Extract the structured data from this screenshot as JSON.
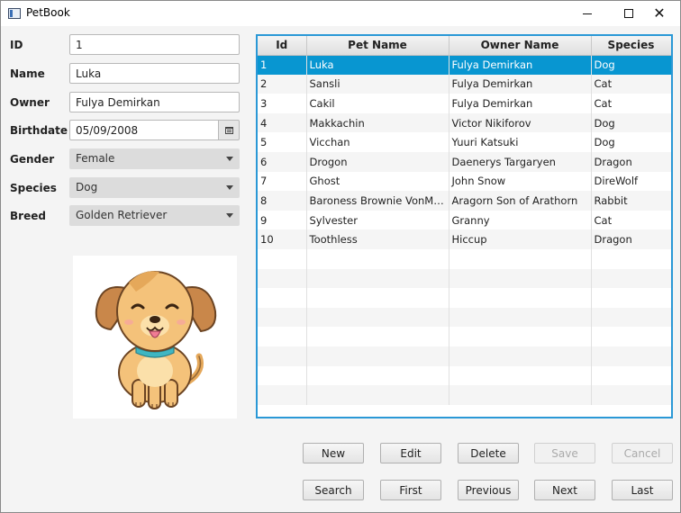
{
  "window": {
    "title": "PetBook"
  },
  "form": {
    "id": {
      "label": "ID",
      "value": "1"
    },
    "name": {
      "label": "Name",
      "value": "Luka"
    },
    "owner": {
      "label": "Owner",
      "value": "Fulya Demirkan"
    },
    "birthdate": {
      "label": "Birthdate",
      "value": "05/09/2008"
    },
    "gender": {
      "label": "Gender",
      "value": "Female"
    },
    "species": {
      "label": "Species",
      "value": "Dog"
    },
    "breed": {
      "label": "Breed",
      "value": "Golden Retriever"
    }
  },
  "table": {
    "columns": [
      "Id",
      "Pet Name",
      "Owner Name",
      "Species"
    ],
    "rows": [
      [
        "1",
        "Luka",
        "Fulya Demirkan",
        "Dog"
      ],
      [
        "2",
        "Sansli",
        "Fulya Demirkan",
        "Cat"
      ],
      [
        "3",
        "Cakil",
        "Fulya Demirkan",
        "Cat"
      ],
      [
        "4",
        "Makkachin",
        "Victor Nikiforov",
        "Dog"
      ],
      [
        "5",
        "Vicchan",
        "Yuuri Katsuki",
        "Dog"
      ],
      [
        "6",
        "Drogon",
        "Daenerys Targaryen",
        "Dragon"
      ],
      [
        "7",
        "Ghost",
        "John Snow",
        "DireWolf"
      ],
      [
        "8",
        "Baroness Brownie VonMarsh...",
        "Aragorn Son of Arathorn",
        "Rabbit"
      ],
      [
        "9",
        "Sylvester",
        "Granny",
        "Cat"
      ],
      [
        "10",
        "Toothless",
        "Hiccup",
        "Dragon"
      ]
    ],
    "selected_row": 1
  },
  "buttons": {
    "new": "New",
    "edit": "Edit",
    "delete": "Delete",
    "save": "Save",
    "cancel": "Cancel",
    "search": "Search",
    "first": "First",
    "previous": "Previous",
    "next": "Next",
    "last": "Last"
  }
}
